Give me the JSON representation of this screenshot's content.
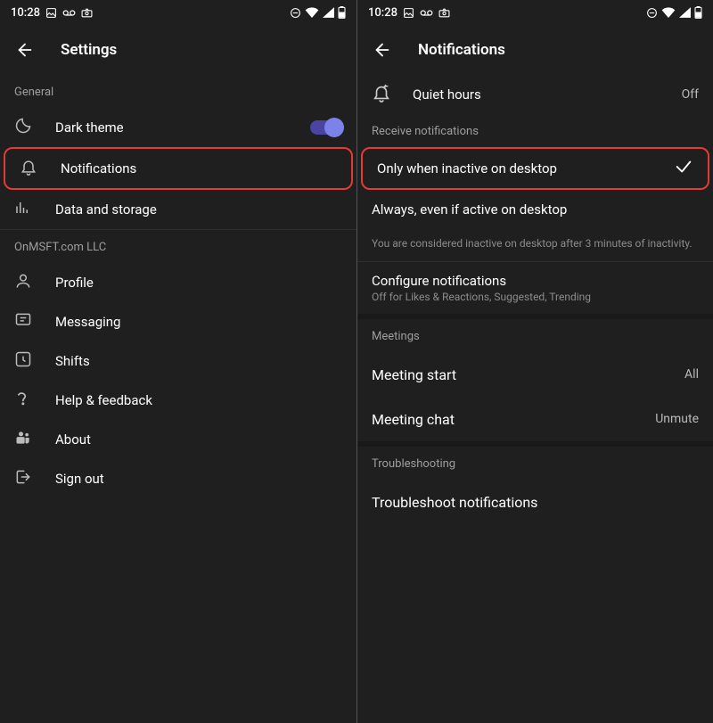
{
  "status": {
    "time": "10:28",
    "icons": [
      "image-icon",
      "voicemail-icon",
      "camera-icon"
    ],
    "right_icons": [
      "dnd-icon",
      "wifi-icon",
      "signal-icon",
      "battery-icon"
    ]
  },
  "left": {
    "title": "Settings",
    "section_general": "General",
    "rows": {
      "dark_theme": "Dark theme",
      "notifications": "Notifications",
      "data_storage": "Data and storage"
    },
    "section_org": "OnMSFT.com LLC",
    "org_rows": {
      "profile": "Profile",
      "messaging": "Messaging",
      "shifts": "Shifts",
      "help": "Help & feedback",
      "about": "About",
      "signout": "Sign out"
    }
  },
  "right": {
    "title": "Notifications",
    "quiet_hours": {
      "label": "Quiet hours",
      "value": "Off"
    },
    "section_receive": "Receive notifications",
    "opt_inactive": "Only when inactive on desktop",
    "opt_always": "Always, even if active on desktop",
    "inactive_help": "You are considered inactive on desktop after 3 minutes of inactivity.",
    "configure": {
      "label": "Configure notifications",
      "sub": "Off for Likes & Reactions, Suggested, Trending"
    },
    "section_meetings": "Meetings",
    "meeting_start": {
      "label": "Meeting start",
      "value": "All"
    },
    "meeting_chat": {
      "label": "Meeting chat",
      "value": "Unmute"
    },
    "section_trouble": "Troubleshooting",
    "troubleshoot": "Troubleshoot notifications"
  }
}
